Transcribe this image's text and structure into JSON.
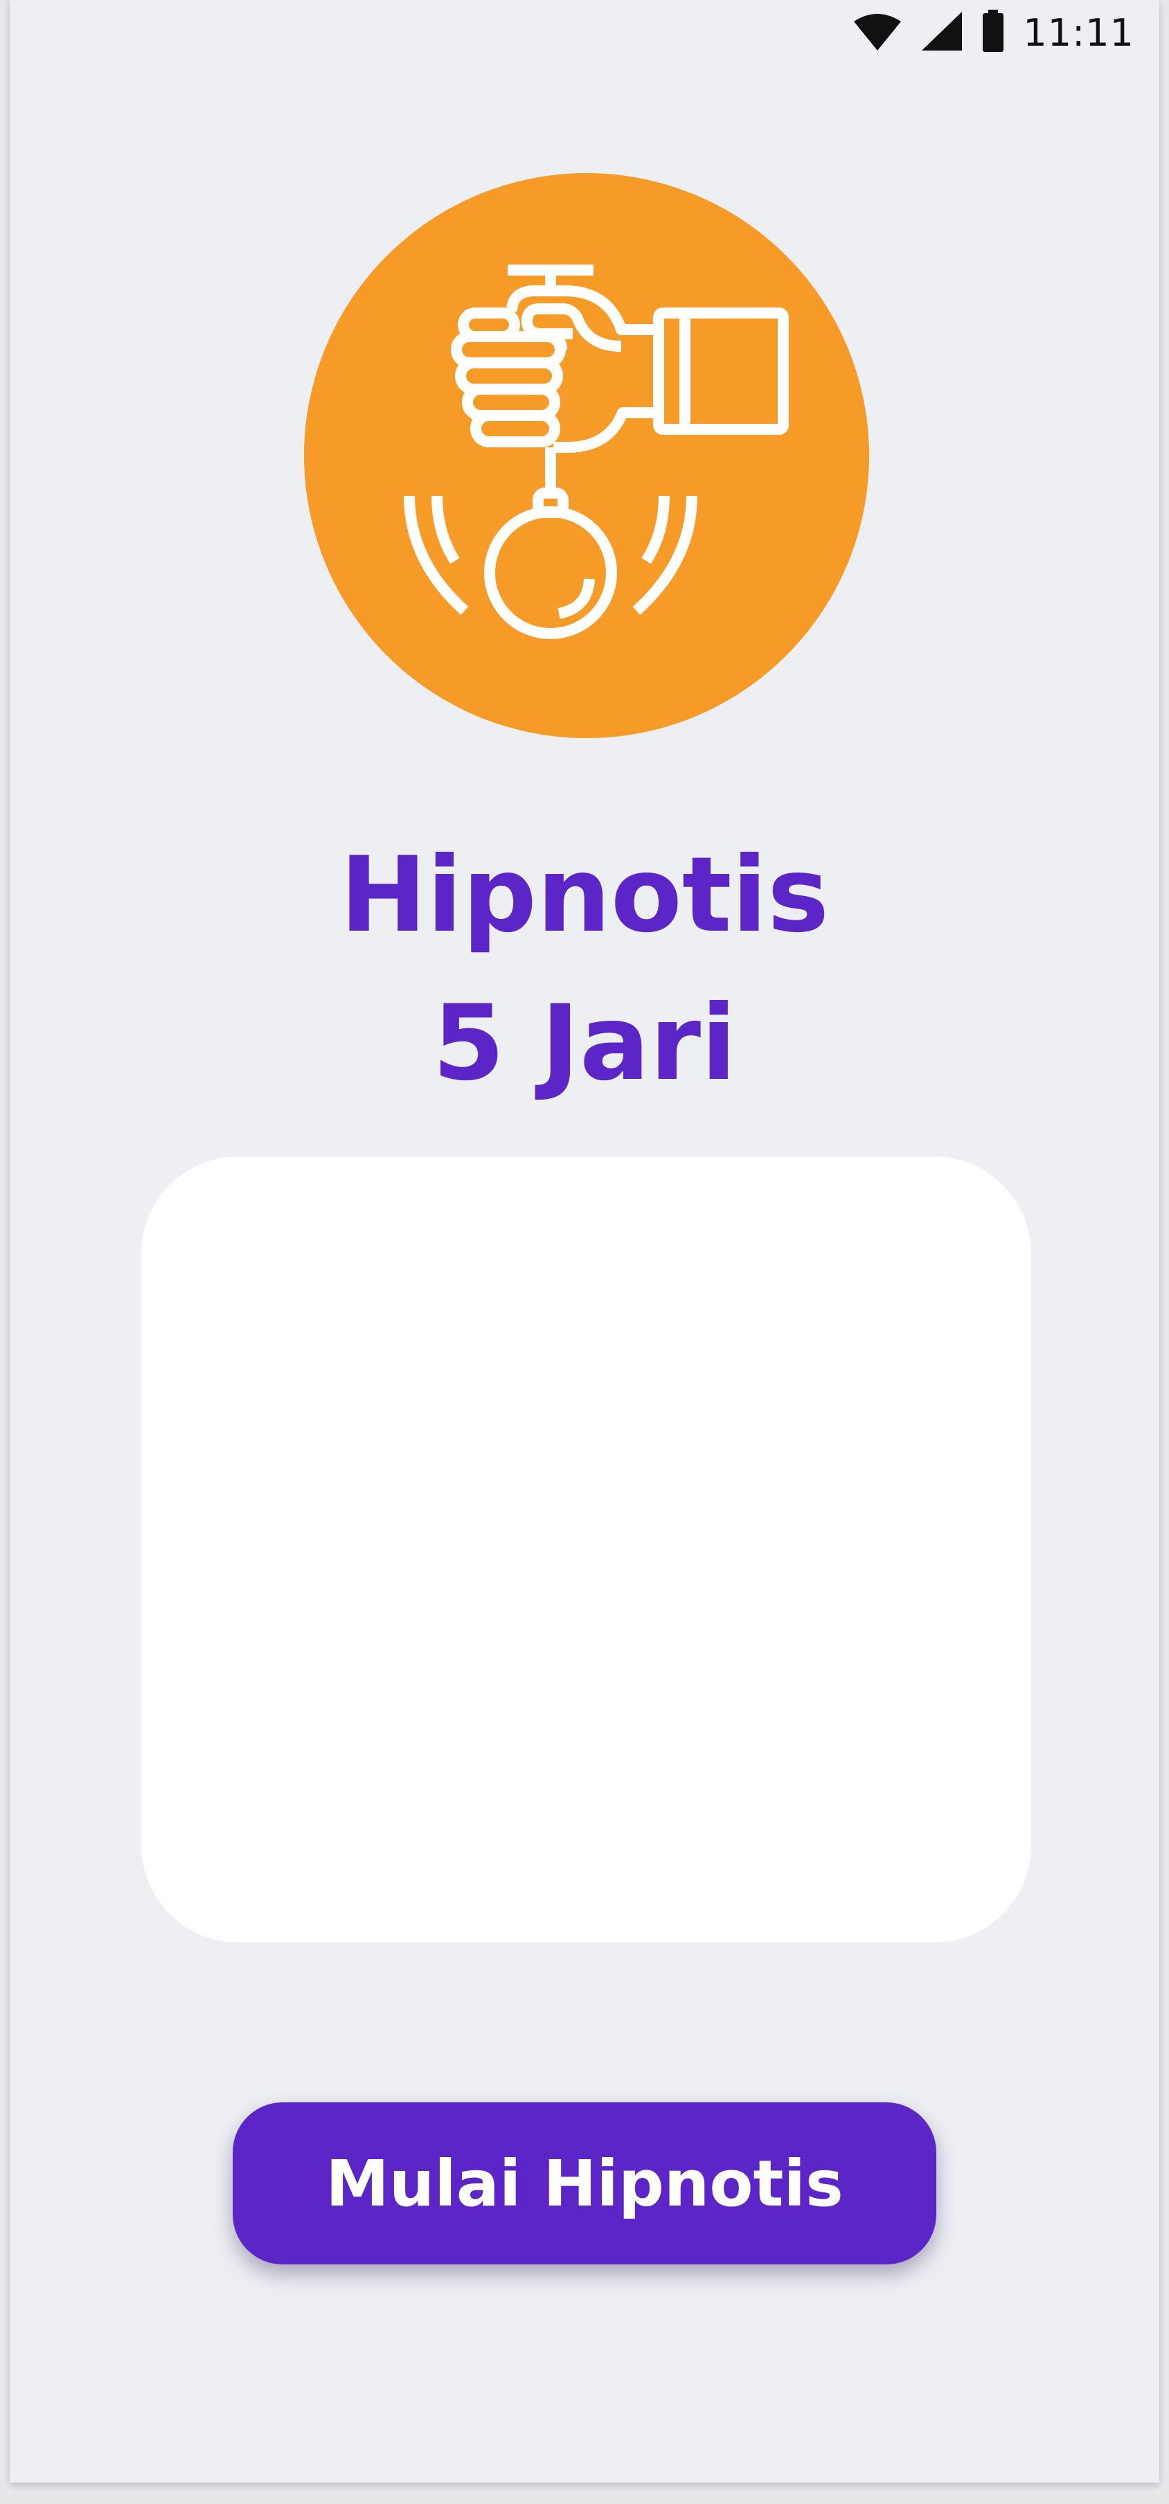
{
  "status_bar": {
    "time": "11:11",
    "icons": [
      "wifi-icon",
      "cellular-signal-icon",
      "battery-icon"
    ]
  },
  "hero": {
    "icon": "hypnosis-pendulum-icon",
    "circle_color": "#f69a28"
  },
  "title": {
    "line1": "Hipnotis",
    "line2": "5 Jari",
    "color": "#5b25c7"
  },
  "start_button": {
    "label": "Mulai Hipnotis",
    "color": "#5b25c7"
  }
}
